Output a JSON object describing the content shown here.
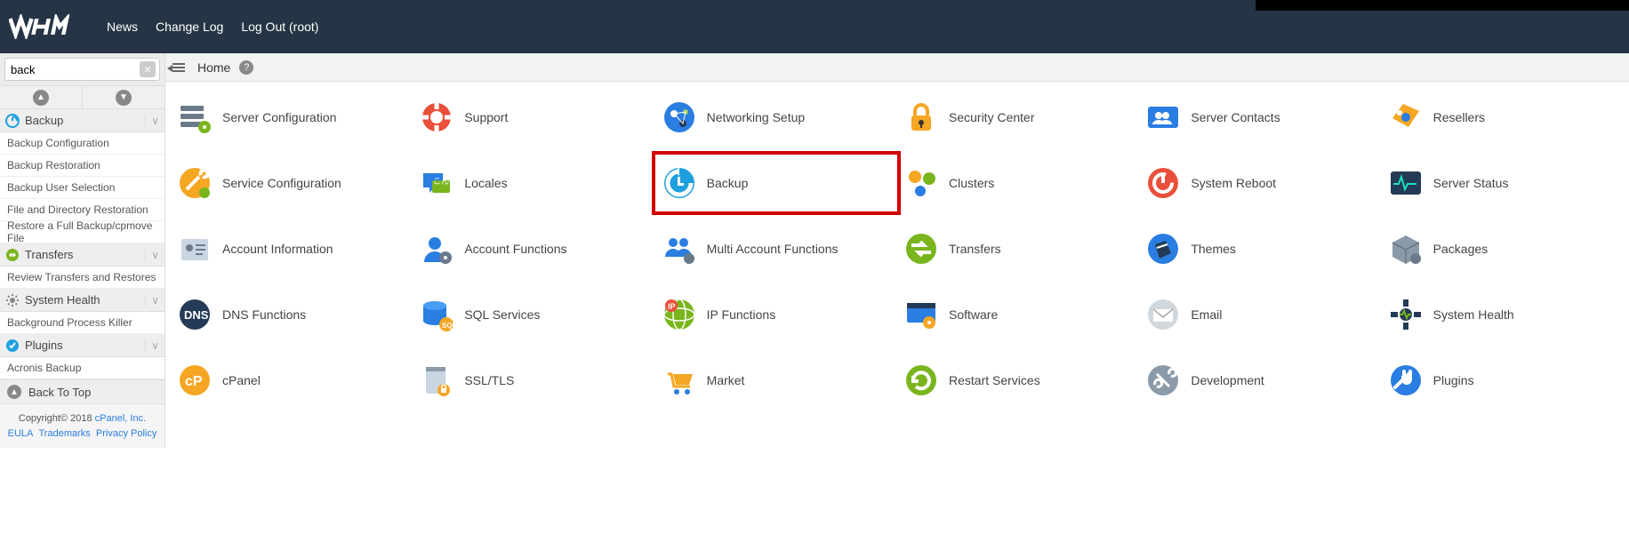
{
  "nav": {
    "news": "News",
    "changelog": "Change Log",
    "logout": "Log Out (root)"
  },
  "search": {
    "value": "back"
  },
  "sidebar": {
    "sections": [
      {
        "label": "Backup",
        "items": [
          "Backup Configuration",
          "Backup Restoration",
          "Backup User Selection",
          "File and Directory Restoration",
          "Restore a Full Backup/cpmove File"
        ]
      },
      {
        "label": "Transfers",
        "items": [
          "Review Transfers and Restores"
        ]
      },
      {
        "label": "System Health",
        "items": [
          "Background Process Killer"
        ]
      },
      {
        "label": "Plugins",
        "items": [
          "Acronis Backup"
        ]
      }
    ],
    "backtotop": "Back To Top"
  },
  "footer": {
    "copyright": "Copyright© 2018 ",
    "cpanel": "cPanel, Inc.",
    "eula": "EULA",
    "trademarks": "Trademarks",
    "privacy": "Privacy Policy"
  },
  "breadcrumb": {
    "label": "Home"
  },
  "tiles": [
    {
      "label": "Server Configuration",
      "icon": "server-config"
    },
    {
      "label": "Support",
      "icon": "support"
    },
    {
      "label": "Networking Setup",
      "icon": "networking"
    },
    {
      "label": "Security Center",
      "icon": "security"
    },
    {
      "label": "Server Contacts",
      "icon": "contacts"
    },
    {
      "label": "Resellers",
      "icon": "resellers"
    },
    {
      "label": "Service Configuration",
      "icon": "service-config"
    },
    {
      "label": "Locales",
      "icon": "locales"
    },
    {
      "label": "Backup",
      "icon": "backup",
      "highlight": true
    },
    {
      "label": "Clusters",
      "icon": "clusters"
    },
    {
      "label": "System Reboot",
      "icon": "reboot"
    },
    {
      "label": "Server Status",
      "icon": "status"
    },
    {
      "label": "Account Information",
      "icon": "account-info"
    },
    {
      "label": "Account Functions",
      "icon": "account-func"
    },
    {
      "label": "Multi Account Functions",
      "icon": "multi-account"
    },
    {
      "label": "Transfers",
      "icon": "transfers"
    },
    {
      "label": "Themes",
      "icon": "themes"
    },
    {
      "label": "Packages",
      "icon": "packages"
    },
    {
      "label": "DNS Functions",
      "icon": "dns"
    },
    {
      "label": "SQL Services",
      "icon": "sql"
    },
    {
      "label": "IP Functions",
      "icon": "ip"
    },
    {
      "label": "Software",
      "icon": "software"
    },
    {
      "label": "Email",
      "icon": "email"
    },
    {
      "label": "System Health",
      "icon": "health"
    },
    {
      "label": "cPanel",
      "icon": "cpanel"
    },
    {
      "label": "SSL/TLS",
      "icon": "ssl"
    },
    {
      "label": "Market",
      "icon": "market"
    },
    {
      "label": "Restart Services",
      "icon": "restart"
    },
    {
      "label": "Development",
      "icon": "development"
    },
    {
      "label": "Plugins",
      "icon": "plugins"
    }
  ]
}
